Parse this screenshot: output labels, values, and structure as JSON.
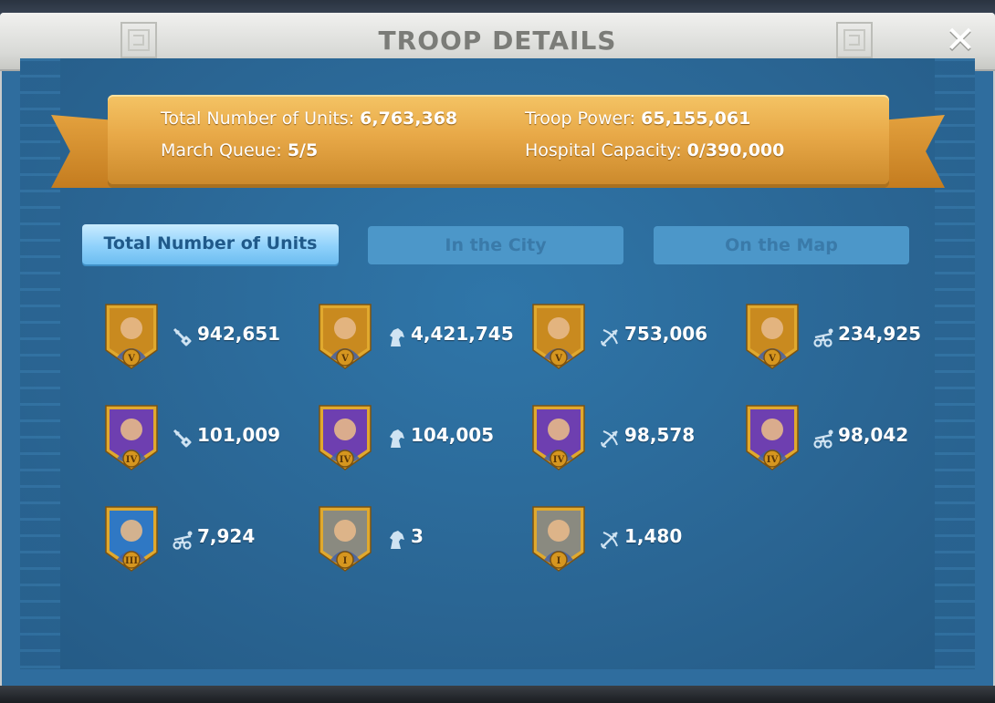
{
  "window": {
    "title": "TROOP DETAILS"
  },
  "summary": {
    "total_units_label": "Total Number of Units:",
    "total_units_value": "6,763,368",
    "troop_power_label": "Troop Power:",
    "troop_power_value": "65,155,061",
    "march_queue_label": "March Queue:",
    "march_queue_value": "5/5",
    "hospital_label": "Hospital Capacity:",
    "hospital_value": "0/390,000"
  },
  "tabs": [
    {
      "label": "Total Number of Units",
      "active": true
    },
    {
      "label": "In the City",
      "active": false
    },
    {
      "label": "On the Map",
      "active": false
    }
  ],
  "units": [
    {
      "tier": "V",
      "type": "infantry",
      "count": "942,651",
      "frame": "gold"
    },
    {
      "tier": "V",
      "type": "cavalry",
      "count": "4,421,745",
      "frame": "gold"
    },
    {
      "tier": "V",
      "type": "archer",
      "count": "753,006",
      "frame": "gold"
    },
    {
      "tier": "V",
      "type": "siege",
      "count": "234,925",
      "frame": "gold"
    },
    {
      "tier": "IV",
      "type": "infantry",
      "count": "101,009",
      "frame": "purple"
    },
    {
      "tier": "IV",
      "type": "cavalry",
      "count": "104,005",
      "frame": "purple"
    },
    {
      "tier": "IV",
      "type": "archer",
      "count": "98,578",
      "frame": "purple"
    },
    {
      "tier": "IV",
      "type": "siege",
      "count": "98,042",
      "frame": "purple"
    },
    {
      "tier": "III",
      "type": "siege",
      "count": "7,924",
      "frame": "blue"
    },
    {
      "tier": "I",
      "type": "cavalry",
      "count": "3",
      "frame": "grey"
    },
    {
      "tier": "I",
      "type": "archer",
      "count": "1,480",
      "frame": "grey"
    }
  ],
  "colors": {
    "gold_frame": "#e0a92e",
    "purple_bg": "#6e3fb0",
    "gold_bg": "#c98a1f",
    "blue_bg": "#2f78c4",
    "grey_bg": "#8a8a80"
  }
}
